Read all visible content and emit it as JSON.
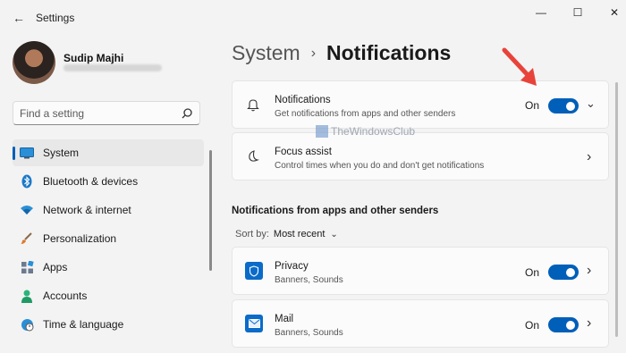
{
  "window": {
    "title": "Settings",
    "back_glyph": "←",
    "min_glyph": "—",
    "max_glyph": "☐",
    "close_glyph": "✕"
  },
  "user": {
    "name": "Sudip Majhi",
    "avatar_icon": "user-avatar"
  },
  "search": {
    "placeholder": "Find a setting",
    "icon": "search-icon"
  },
  "sidebar": {
    "items": [
      {
        "label": "System",
        "icon": "monitor-icon",
        "active": true
      },
      {
        "label": "Bluetooth & devices",
        "icon": "bluetooth-icon"
      },
      {
        "label": "Network & internet",
        "icon": "wifi-icon"
      },
      {
        "label": "Personalization",
        "icon": "brush-icon"
      },
      {
        "label": "Apps",
        "icon": "apps-icon"
      },
      {
        "label": "Accounts",
        "icon": "person-icon"
      },
      {
        "label": "Time & language",
        "icon": "globe-clock-icon"
      }
    ]
  },
  "breadcrumb": {
    "parent": "System",
    "separator": "›",
    "current": "Notifications"
  },
  "cards": {
    "notifications": {
      "title": "Notifications",
      "subtitle": "Get notifications from apps and other senders",
      "state": "On",
      "icon": "bell-icon",
      "chevron": "⌄"
    },
    "focus_assist": {
      "title": "Focus assist",
      "subtitle": "Control times when you do and don't get notifications",
      "icon": "moon-icon",
      "chevron": "›"
    }
  },
  "apps_section": {
    "heading": "Notifications from apps and other senders",
    "sort_label": "Sort by:",
    "sort_value": "Most recent",
    "sort_chevron": "⌄",
    "apps": [
      {
        "name": "Privacy",
        "subtitle": "Banners, Sounds",
        "state": "On",
        "icon": "shield-icon",
        "chevron": "›"
      },
      {
        "name": "Mail",
        "subtitle": "Banners, Sounds",
        "state": "On",
        "icon": "mail-icon",
        "chevron": "›"
      }
    ]
  },
  "watermark": {
    "text": "TheWindowsClub"
  },
  "colors": {
    "accent": "#005fb8",
    "background": "#f3f3f3",
    "card": "#fbfbfb",
    "annotation_arrow": "#e8433a"
  }
}
